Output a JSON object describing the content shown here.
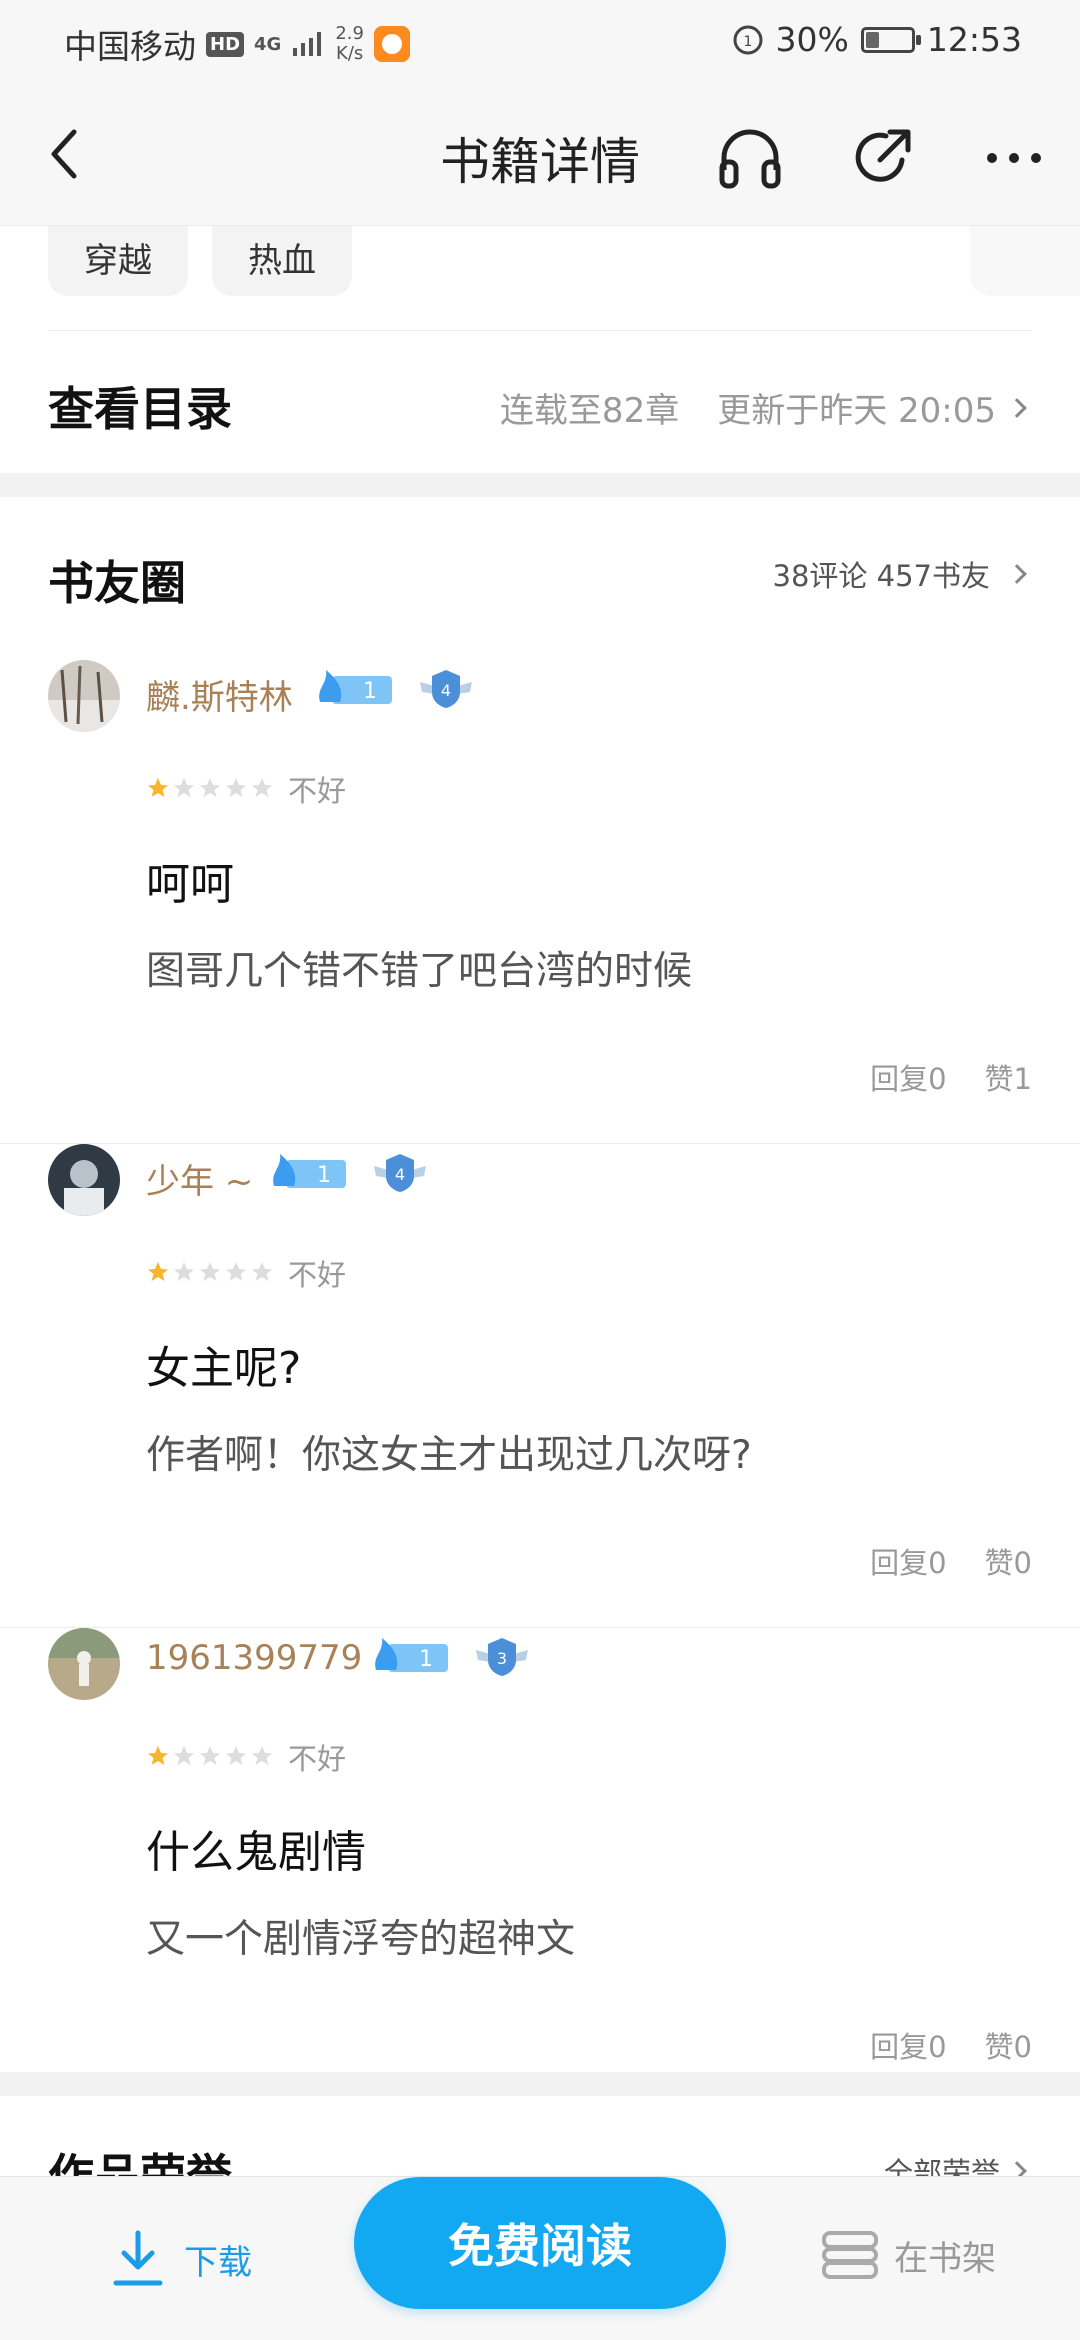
{
  "status_bar": {
    "carrier": "中国移动",
    "hd": "HD",
    "network": "4G",
    "speed_value": "2.9",
    "speed_unit": "K/s",
    "battery_percent": "30%",
    "battery_level": 0.3,
    "time": "12:53"
  },
  "nav": {
    "title": "书籍详情"
  },
  "tags": [
    "穿越",
    "热血"
  ],
  "catalog": {
    "label": "查看目录",
    "serial": "连载至82章",
    "updated": "更新于昨天 20:05"
  },
  "circle": {
    "label": "书友圈",
    "stats": "38评论 457书友",
    "comments": [
      {
        "username": "麟.斯特林",
        "fans_level": "1",
        "user_level": "4",
        "rating": 1,
        "rating_text": "不好",
        "title": "呵呵",
        "body": "图哥几个错不错了吧台湾的时候",
        "reply": "回复0",
        "like": "赞1"
      },
      {
        "username": "少年 ~",
        "fans_level": "1",
        "user_level": "4",
        "rating": 1,
        "rating_text": "不好",
        "title": "女主呢?",
        "body": "作者啊！你这女主才出现过几次呀?",
        "reply": "回复0",
        "like": "赞0"
      },
      {
        "username": "1961399779",
        "fans_level": "1",
        "user_level": "3",
        "rating": 1,
        "rating_text": "不好",
        "title": "什么鬼剧情",
        "body": "又一个剧情浮夸的超神文",
        "reply": "回复0",
        "like": "赞0"
      }
    ]
  },
  "honors": {
    "label": "作品荣誉",
    "more": "全部荣誉"
  },
  "bottom": {
    "download": "下载",
    "read": "免费阅读",
    "shelf": "在书架"
  },
  "colors": {
    "accent": "#12a8f2",
    "username": "#a88256",
    "star_on": "#f7b52c",
    "star_off": "#dddddd"
  }
}
